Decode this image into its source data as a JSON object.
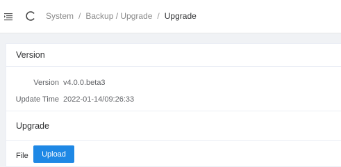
{
  "header": {
    "menu_icon": "menu-icon",
    "refresh_icon": "refresh-icon",
    "breadcrumb": [
      "System",
      "Backup / Upgrade",
      "Upgrade"
    ]
  },
  "version_card": {
    "title": "Version",
    "version_label": "Version",
    "version_value": "v4.0.0.beta3",
    "update_label": "Update Time",
    "update_value": "2022-01-14/09:26:33"
  },
  "upgrade_card": {
    "title": "Upgrade",
    "file_label": "File",
    "upload_label": "Upload"
  },
  "colors": {
    "accent": "#1e88e5",
    "background": "#f0f2f5"
  }
}
